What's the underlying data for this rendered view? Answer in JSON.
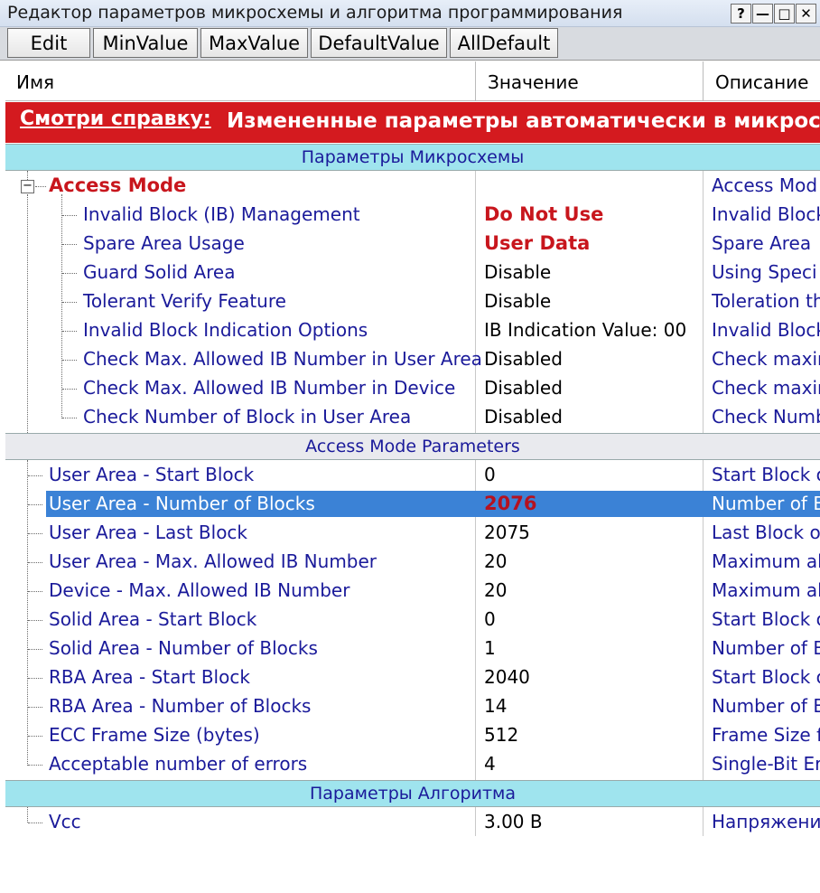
{
  "window": {
    "title": "Редактор параметров микросхемы и алгоритма программирования",
    "help_glyph": "?",
    "minimize_glyph": "—",
    "maximize_glyph": "□",
    "close_glyph": "✕"
  },
  "toolbar": {
    "edit": "Edit",
    "min_value": "MinValue",
    "max_value": "MaxValue",
    "default_value": "DefaultValue",
    "all_default": "AllDefault"
  },
  "columns": {
    "name": "Имя",
    "value": "Значение",
    "description": "Описание"
  },
  "banner": {
    "link": "Смотри справку:",
    "text": "Измененные параметры автоматически в микросх"
  },
  "sections": {
    "chip": "Параметры Микросхемы",
    "access_mode_params": "Access Mode Parameters",
    "algorithm": "Параметры Алгоритма"
  },
  "access_mode": {
    "name": "Access Mode",
    "value": "",
    "description": "Access Mod",
    "children": [
      {
        "name": "Invalid Block (IB) Management",
        "value": "Do Not Use",
        "description": "Invalid Block"
      },
      {
        "name": "Spare Area Usage",
        "value": "User Data",
        "description": "Spare Area"
      },
      {
        "name": "Guard Solid Area",
        "value": "Disable",
        "description": "Using Speci"
      },
      {
        "name": "Tolerant Verify Feature",
        "value": "Disable",
        "description": "Toleration th"
      },
      {
        "name": "Invalid Block Indication Options",
        "value": "IB Indication Value: 00",
        "description": "Invalid Block"
      },
      {
        "name": "Check Max. Allowed IB Number in User Area",
        "value": "Disabled",
        "description": "Check maxin"
      },
      {
        "name": "Check Max. Allowed IB Number in Device",
        "value": "Disabled",
        "description": "Check maxin"
      },
      {
        "name": "Check Number of Block in User Area",
        "value": "Disabled",
        "description": "Check Numb"
      }
    ]
  },
  "params": [
    {
      "name": "User Area - Start Block",
      "value": "0",
      "description": "Start Block o"
    },
    {
      "name": "User Area - Number of Blocks",
      "value": "2076",
      "description": "Number of B"
    },
    {
      "name": "User Area - Last Block",
      "value": "2075",
      "description": "Last Block o"
    },
    {
      "name": "User Area - Max. Allowed IB Number",
      "value": "20",
      "description": "Maximum all"
    },
    {
      "name": "Device - Max. Allowed IB Number",
      "value": "20",
      "description": "Maximum all"
    },
    {
      "name": "Solid Area - Start Block",
      "value": "0",
      "description": "Start Block o"
    },
    {
      "name": "Solid Area - Number of Blocks",
      "value": "1",
      "description": "Number of B"
    },
    {
      "name": "RBA Area - Start Block",
      "value": "2040",
      "description": "Start Block o"
    },
    {
      "name": "RBA Area - Number of Blocks",
      "value": "14",
      "description": "Number of B"
    },
    {
      "name": "ECC Frame Size (bytes)",
      "value": "512",
      "description": "Frame Size f"
    },
    {
      "name": "Acceptable number of errors",
      "value": "4",
      "description": "Single-Bit Er"
    }
  ],
  "algorithm_params": [
    {
      "name": "Vcc",
      "value": "3.00 В",
      "description": "Напряжени"
    }
  ],
  "colors": {
    "banner_bg": "#d41a1f",
    "section_cyan": "#9fe4ee",
    "selection": "#3b82d6",
    "accent_red": "#c8161d"
  }
}
